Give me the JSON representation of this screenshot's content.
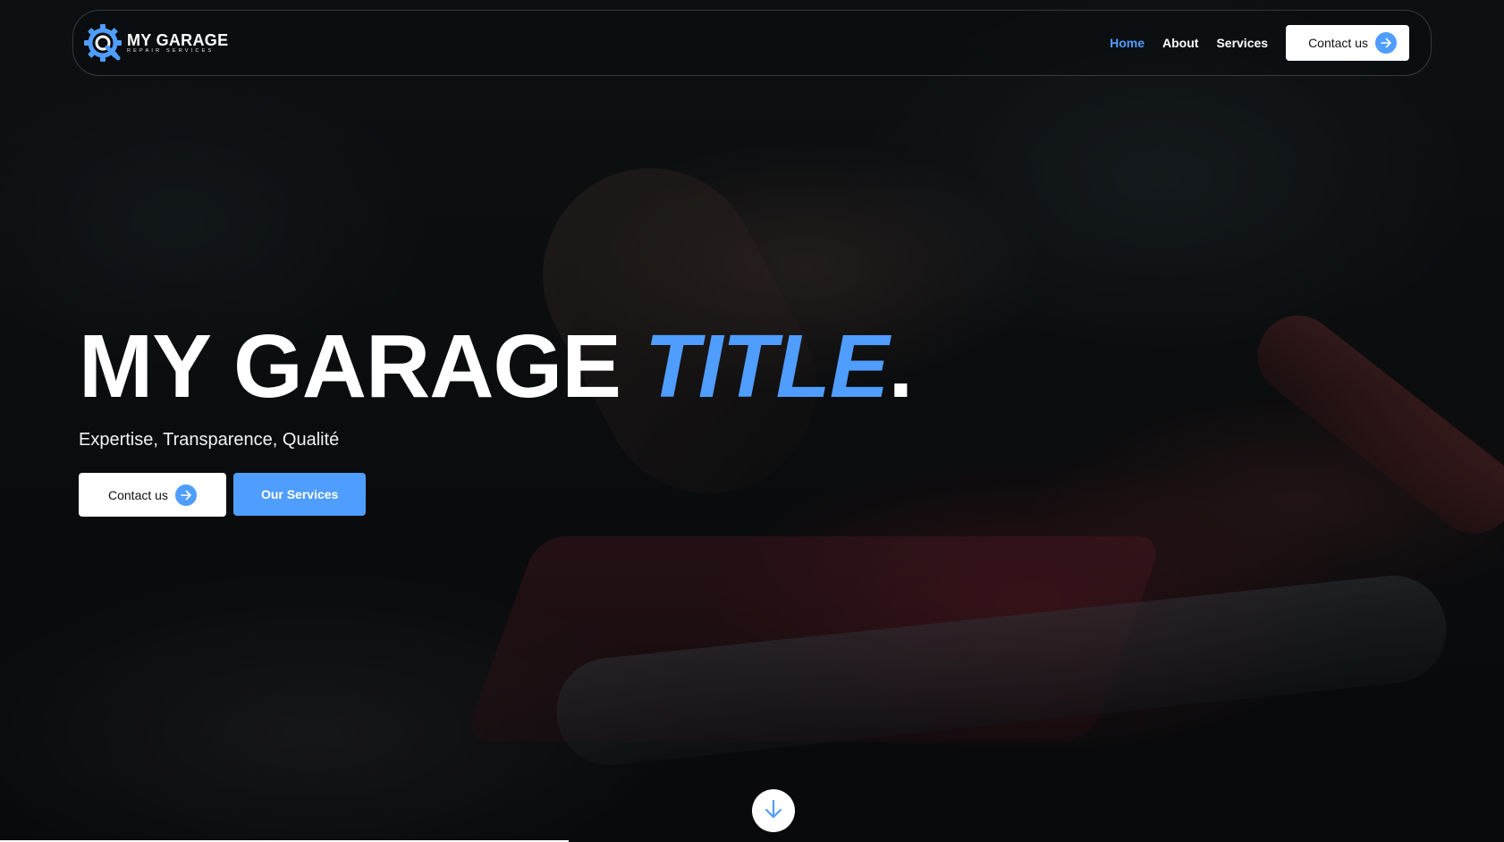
{
  "brand": {
    "name": "MY GARAGE",
    "tagline": "REPAIR SERVICES",
    "logo_icon": "gear-wrench-icon",
    "accent_color": "#4f9dff"
  },
  "nav": {
    "links": [
      {
        "label": "Home",
        "active": true
      },
      {
        "label": "About",
        "active": false
      },
      {
        "label": "Services",
        "active": false
      }
    ],
    "contact_label": "Contact us",
    "contact_icon": "arrow-right-icon"
  },
  "hero": {
    "title_main": "MY GARAGE",
    "title_accent": "TITLE",
    "title_end": ".",
    "subtitle": "Expertise, Transparence, Qualité",
    "primary_cta": "Contact us",
    "primary_cta_icon": "arrow-right-icon",
    "secondary_cta": "Our Services"
  },
  "scroll": {
    "icon": "arrow-down-icon"
  },
  "colors": {
    "accent": "#4f9dff",
    "button_bg": "#ffffff",
    "text": "#ffffff"
  }
}
